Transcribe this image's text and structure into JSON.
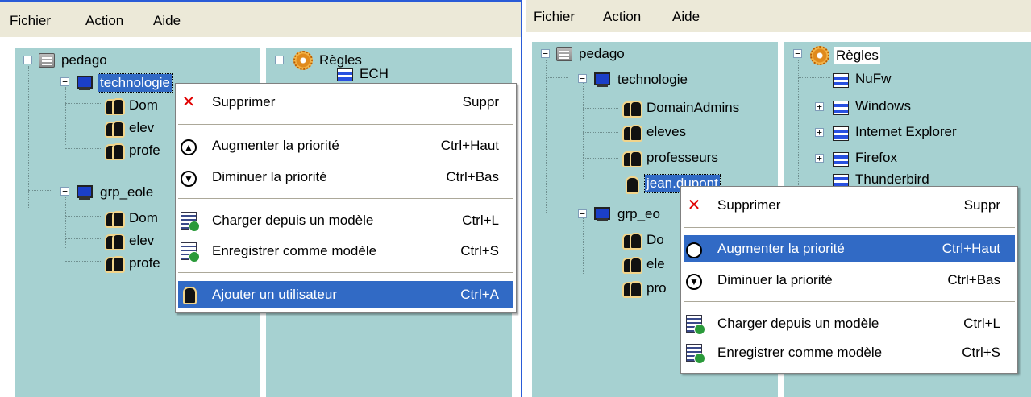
{
  "menubar": {
    "file": "Fichier",
    "action": "Action",
    "help": "Aide"
  },
  "left_tree": {
    "root": "pedago",
    "group1": "technologie",
    "group1_children": [
      "Dom",
      "elev",
      "profe"
    ],
    "group2": "grp_eole",
    "group2_children": [
      "Dom",
      "elev",
      "profe"
    ]
  },
  "left_rules": {
    "root": "Règles",
    "child_partial": "ECH"
  },
  "left_menu": {
    "delete": {
      "label": "Supprimer",
      "shortcut": "Suppr"
    },
    "raise": {
      "label": "Augmenter la priorité",
      "shortcut": "Ctrl+Haut"
    },
    "lower": {
      "label": "Diminuer la priorité",
      "shortcut": "Ctrl+Bas"
    },
    "load": {
      "label": "Charger depuis un modèle",
      "shortcut": "Ctrl+L"
    },
    "save": {
      "label": "Enregistrer comme modèle",
      "shortcut": "Ctrl+S"
    },
    "add_user": {
      "label": "Ajouter un utilisateur",
      "shortcut": "Ctrl+A"
    }
  },
  "right_tree": {
    "root": "pedago",
    "group1": "technologie",
    "group1_children": [
      "DomainAdmins",
      "eleves",
      "professeurs",
      "jean.dupont"
    ],
    "group2": "grp_eo",
    "group2_children": [
      "Do",
      "ele",
      "pro"
    ]
  },
  "right_rules": {
    "root": "Règles",
    "items": [
      "NuFw",
      "Windows",
      "Internet Explorer",
      "Firefox",
      "Thunderbird"
    ]
  },
  "right_menu": {
    "delete": {
      "label": "Supprimer",
      "shortcut": "Suppr"
    },
    "raise": {
      "label": "Augmenter la priorité",
      "shortcut": "Ctrl+Haut"
    },
    "lower": {
      "label": "Diminuer la priorité",
      "shortcut": "Ctrl+Bas"
    },
    "load": {
      "label": "Charger depuis un modèle",
      "shortcut": "Ctrl+L"
    },
    "save": {
      "label": "Enregistrer comme modèle",
      "shortcut": "Ctrl+S"
    }
  },
  "colors": {
    "pane": "#a6d1d1",
    "menubar": "#ece9d8",
    "highlight": "#316ac5",
    "window_border": "#2a5bd7"
  }
}
